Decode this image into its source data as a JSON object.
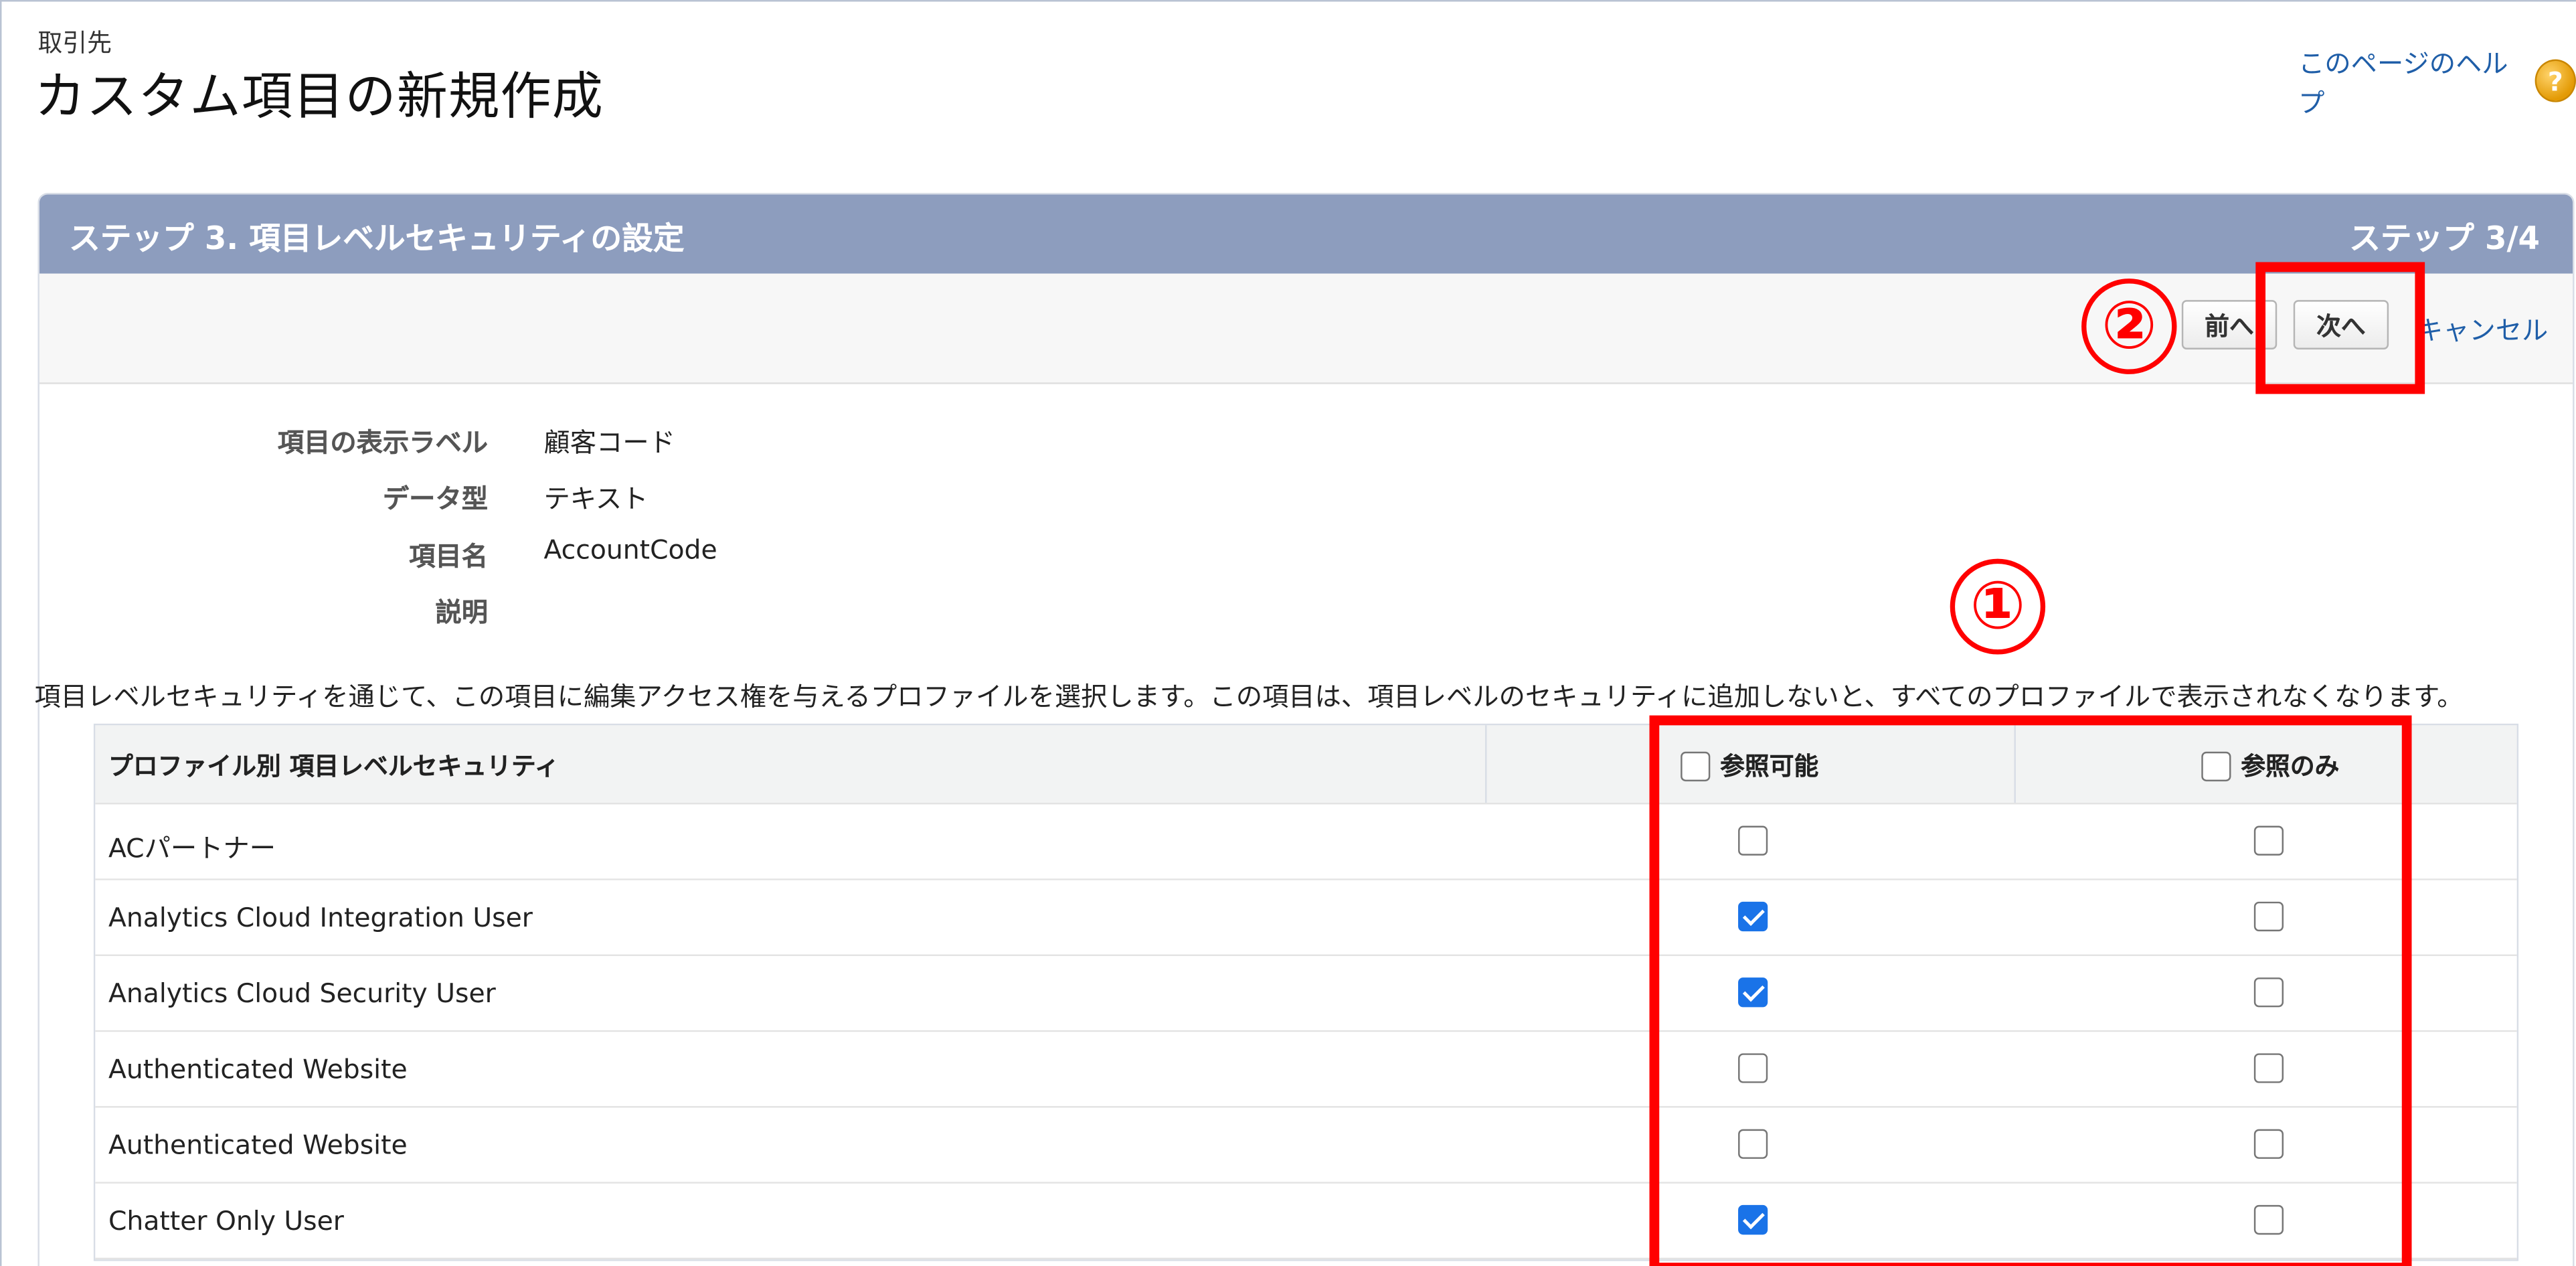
{
  "header": {
    "breadcrumb": "取引先",
    "title": "カスタム項目の新規作成",
    "help_link": "このページのヘルプ",
    "help_icon": "question-circle-icon"
  },
  "step": {
    "title": "ステップ 3. 項目レベルセキュリティの設定",
    "counter": "ステップ 3/4"
  },
  "buttons": {
    "prev": "前へ",
    "next": "次へ",
    "cancel": "キャンセル"
  },
  "field_details": [
    {
      "label": "項目の表示ラベル",
      "value": "顧客コード"
    },
    {
      "label": "データ型",
      "value": "テキスト"
    },
    {
      "label": "項目名",
      "value": "AccountCode"
    },
    {
      "label": "説明",
      "value": ""
    }
  ],
  "intro_text": "項目レベルセキュリティを通じて、この項目に編集アクセス権を与えるプロファイルを選択します。この項目は、項目レベルのセキュリティに追加しないと、すべてのプロファイルで表示されなくなります。",
  "table": {
    "header_profile": "プロファイル別 項目レベルセキュリティ",
    "header_visible": "参照可能",
    "header_readonly": "参照のみ",
    "rows": [
      {
        "profile": "ACパートナー",
        "visible": false,
        "readonly": false
      },
      {
        "profile": "Analytics Cloud Integration User",
        "visible": true,
        "readonly": false
      },
      {
        "profile": "Analytics Cloud Security User",
        "visible": true,
        "readonly": false
      },
      {
        "profile": "Authenticated Website",
        "visible": false,
        "readonly": false
      },
      {
        "profile": "Authenticated Website",
        "visible": false,
        "readonly": false
      },
      {
        "profile": "Chatter Only User",
        "visible": true,
        "readonly": false
      }
    ]
  },
  "annotations": {
    "marker_1": "①",
    "marker_2": "②",
    "color": "#ff0000"
  },
  "colors": {
    "step_header_bg": "#8d9dbe",
    "link": "#1f5ea8",
    "checkbox_checked": "#1a73e8"
  }
}
